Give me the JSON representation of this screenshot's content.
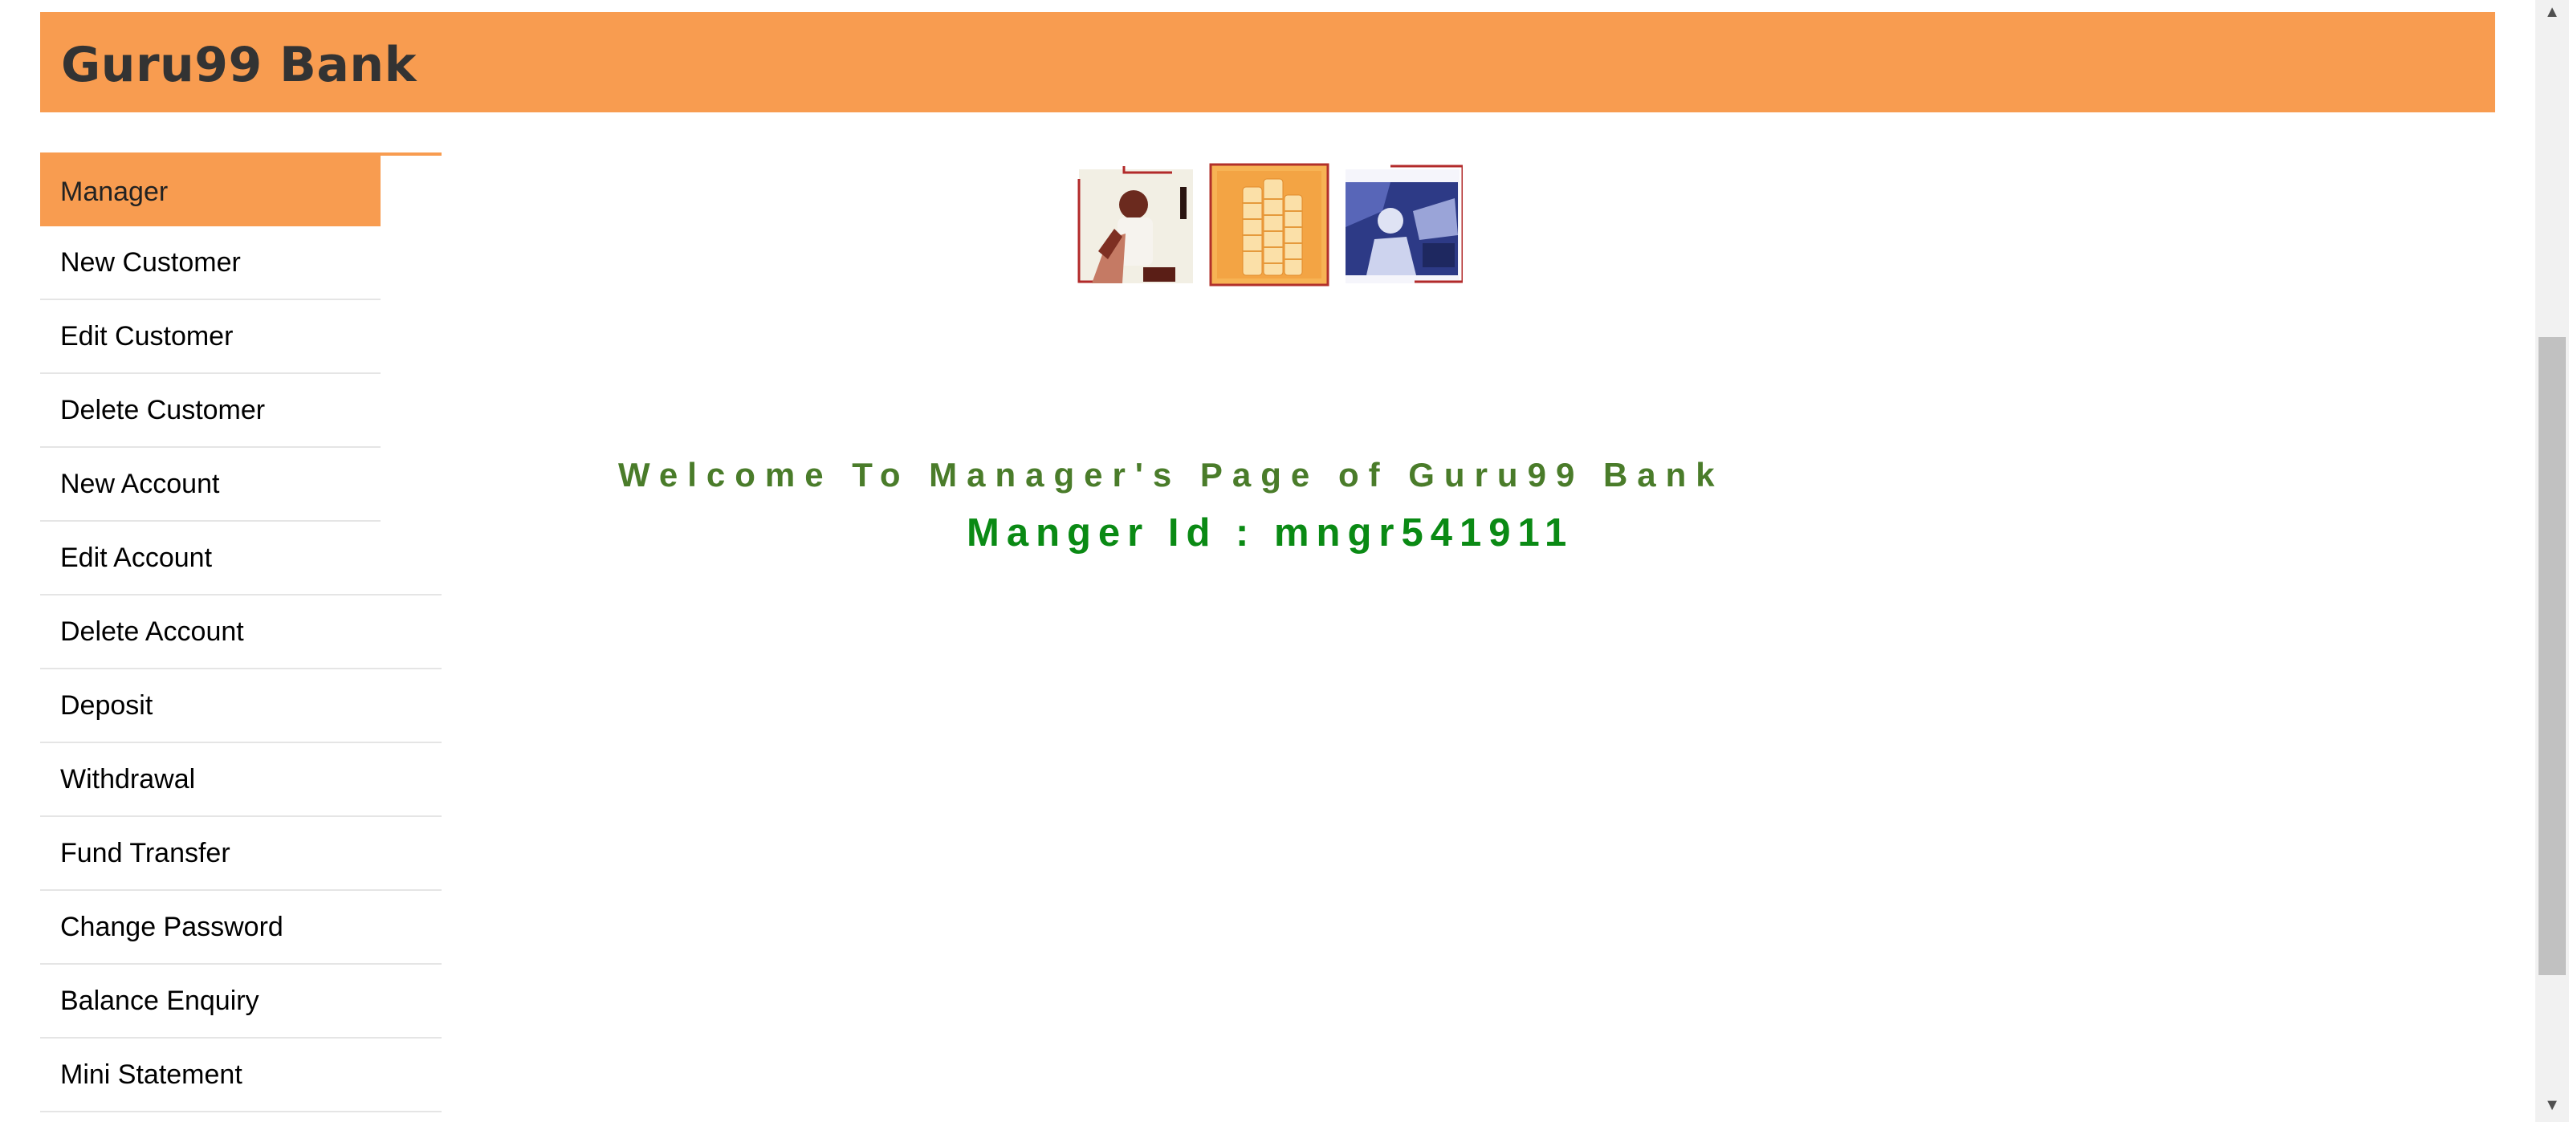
{
  "header": {
    "title": "Guru99 Bank"
  },
  "nav": {
    "items": [
      {
        "label": "Manager",
        "active": true
      },
      {
        "label": "New Customer"
      },
      {
        "label": "Edit Customer"
      },
      {
        "label": "Delete Customer"
      },
      {
        "label": "New Account"
      },
      {
        "label": "Edit Account"
      },
      {
        "label": "Delete Account"
      },
      {
        "label": "Deposit"
      },
      {
        "label": "Withdrawal"
      },
      {
        "label": "Fund Transfer"
      },
      {
        "label": "Change Password"
      },
      {
        "label": "Balance Enquiry"
      },
      {
        "label": "Mini Statement"
      }
    ]
  },
  "main": {
    "welcome": "Welcome To Manager's Page of Guru99 Bank",
    "manager_id": "Manger Id : mngr541911"
  },
  "colors": {
    "accent": "#f89c50",
    "welcome_text": "#4a7c2a",
    "manager_id_text": "#0a8a14"
  },
  "icons": {
    "logo_tiles": [
      "businessman-phone-image",
      "coins-stack-image",
      "woman-office-image"
    ],
    "scroll_up": "scroll-up-arrow-icon",
    "scroll_down": "scroll-down-arrow-icon"
  }
}
